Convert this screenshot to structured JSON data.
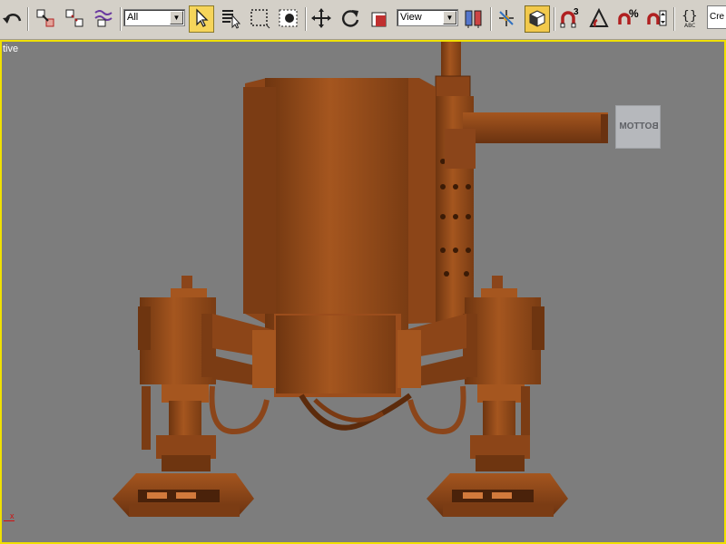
{
  "toolbar": {
    "selection_filter": {
      "value": "All"
    },
    "reference_coord": {
      "value": "View"
    },
    "named_selection_partial": "Cre",
    "spinner_snap_label": "%",
    "angle_snap_label": "3"
  },
  "viewport": {
    "label_visible": "tive",
    "viewcube_face": "BOTTOM",
    "axis_label": "x"
  },
  "colors": {
    "background": "#7d7d7d",
    "active_border": "#f0e000",
    "model": "#9b4d1c",
    "toolbar": "#d4d0c8"
  }
}
